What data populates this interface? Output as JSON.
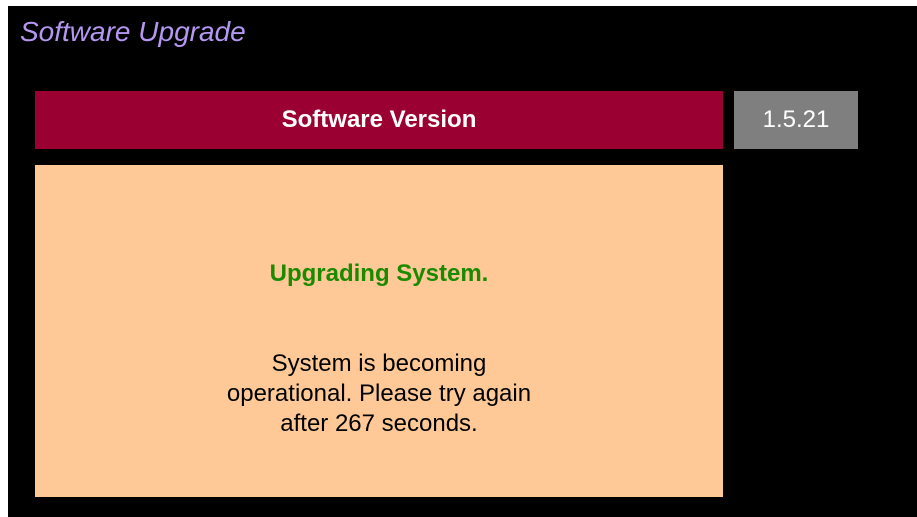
{
  "page": {
    "title": "Software Upgrade"
  },
  "version": {
    "label": "Software Version",
    "value": "1.5.21"
  },
  "status": {
    "heading": "Upgrading System.",
    "message_lines": [
      "System is becoming",
      "operational. Please try again",
      "after 267 seconds."
    ]
  },
  "colors": {
    "background": "#000000",
    "title": "#b497f0",
    "version_label_bg": "#9b0033",
    "version_value_bg": "#7f7f7f",
    "panel_bg": "#fec997",
    "heading": "#1b8a00"
  }
}
